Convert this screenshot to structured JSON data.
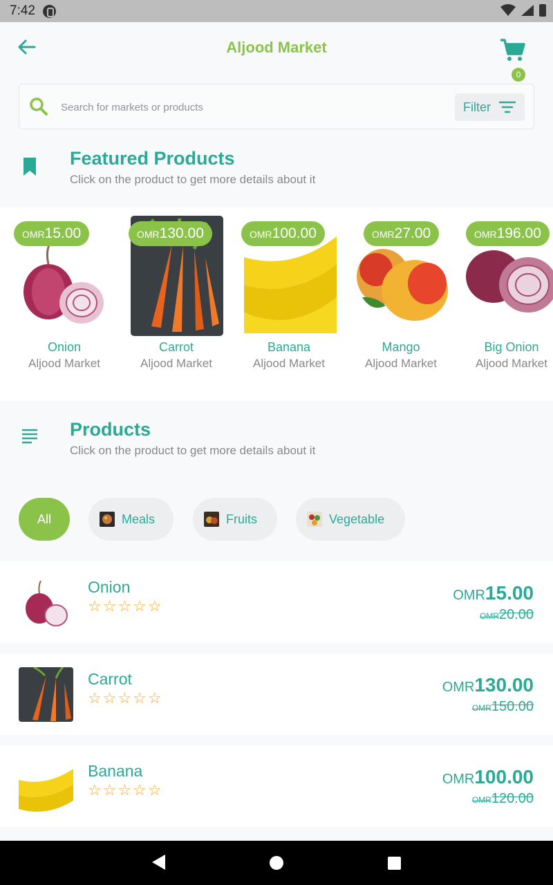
{
  "status_bar": {
    "time": "7:42"
  },
  "app_bar": {
    "title": "Aljood Market",
    "cart_count": "0"
  },
  "search": {
    "placeholder": "Search for markets or products",
    "filter_label": "Filter"
  },
  "featured": {
    "title": "Featured Products",
    "subtitle": "Click on the product to get more details about it",
    "items": [
      {
        "name": "Onion",
        "market": "Aljood Market",
        "currency": "OMR",
        "price": "15.00",
        "image": "onion"
      },
      {
        "name": "Carrot",
        "market": "Aljood Market",
        "currency": "OMR",
        "price": "130.00",
        "image": "carrot"
      },
      {
        "name": "Banana",
        "market": "Aljood Market",
        "currency": "OMR",
        "price": "100.00",
        "image": "banana"
      },
      {
        "name": "Mango",
        "market": "Aljood Market",
        "currency": "OMR",
        "price": "27.00",
        "image": "mango"
      },
      {
        "name": "Big Onion",
        "market": "Aljood Market",
        "currency": "OMR",
        "price": "196.00",
        "image": "big-onion"
      }
    ]
  },
  "products": {
    "title": "Products",
    "subtitle": "Click on the product to get more details about it",
    "categories": [
      {
        "label": "All",
        "active": true
      },
      {
        "label": "Meals",
        "active": false
      },
      {
        "label": "Fruits",
        "active": false
      },
      {
        "label": "Vegetable",
        "active": false
      }
    ],
    "items": [
      {
        "name": "Onion",
        "currency": "OMR",
        "price": "15.00",
        "old_currency": "OMR",
        "old_price": "20.00",
        "rating": 0
      },
      {
        "name": "Carrot",
        "currency": "OMR",
        "price": "130.00",
        "old_currency": "OMR",
        "old_price": "150.00",
        "rating": 0
      },
      {
        "name": "Banana",
        "currency": "OMR",
        "price": "100.00",
        "old_currency": "OMR",
        "old_price": "120.00",
        "rating": 0
      }
    ],
    "stars": "☆☆☆☆☆"
  },
  "colors": {
    "primary": "#2aa995",
    "accent": "#8bc34a",
    "star": "#ffa726"
  }
}
